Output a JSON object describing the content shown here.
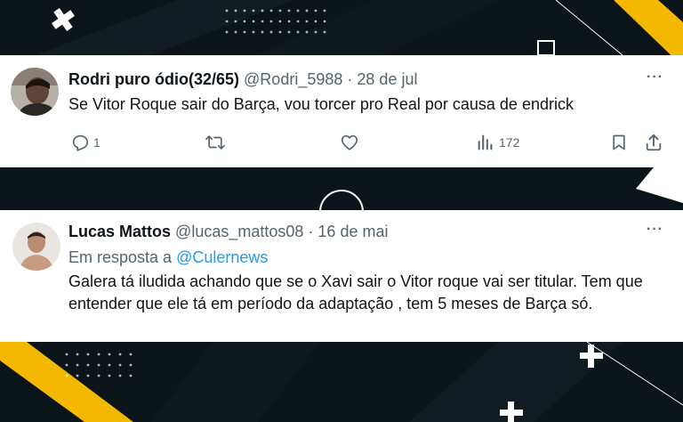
{
  "tweets": [
    {
      "display_name": "Rodri puro ódio(32/65)",
      "handle": "@Rodri_5988",
      "date": "28 de jul",
      "text": "Se Vitor Roque sair do Barça, vou torcer pro Real por causa de endrick",
      "replies": "1",
      "views": "172",
      "more": "···"
    },
    {
      "display_name": "Lucas Mattos",
      "handle": "@lucas_mattos08",
      "date": "16 de mai",
      "reply_prefix": "Em resposta a",
      "reply_mention": "@Culernews",
      "text": "Galera tá iludida achando que se o Xavi sair o Vitor roque vai ser titular. Tem que entender que ele tá em período da adaptação , tem 5 meses de Barça só.",
      "more": "···"
    }
  ],
  "colors": {
    "accent_yellow": "#f5b800",
    "mention_blue": "#1d9bf0",
    "background": "#0a1216"
  }
}
